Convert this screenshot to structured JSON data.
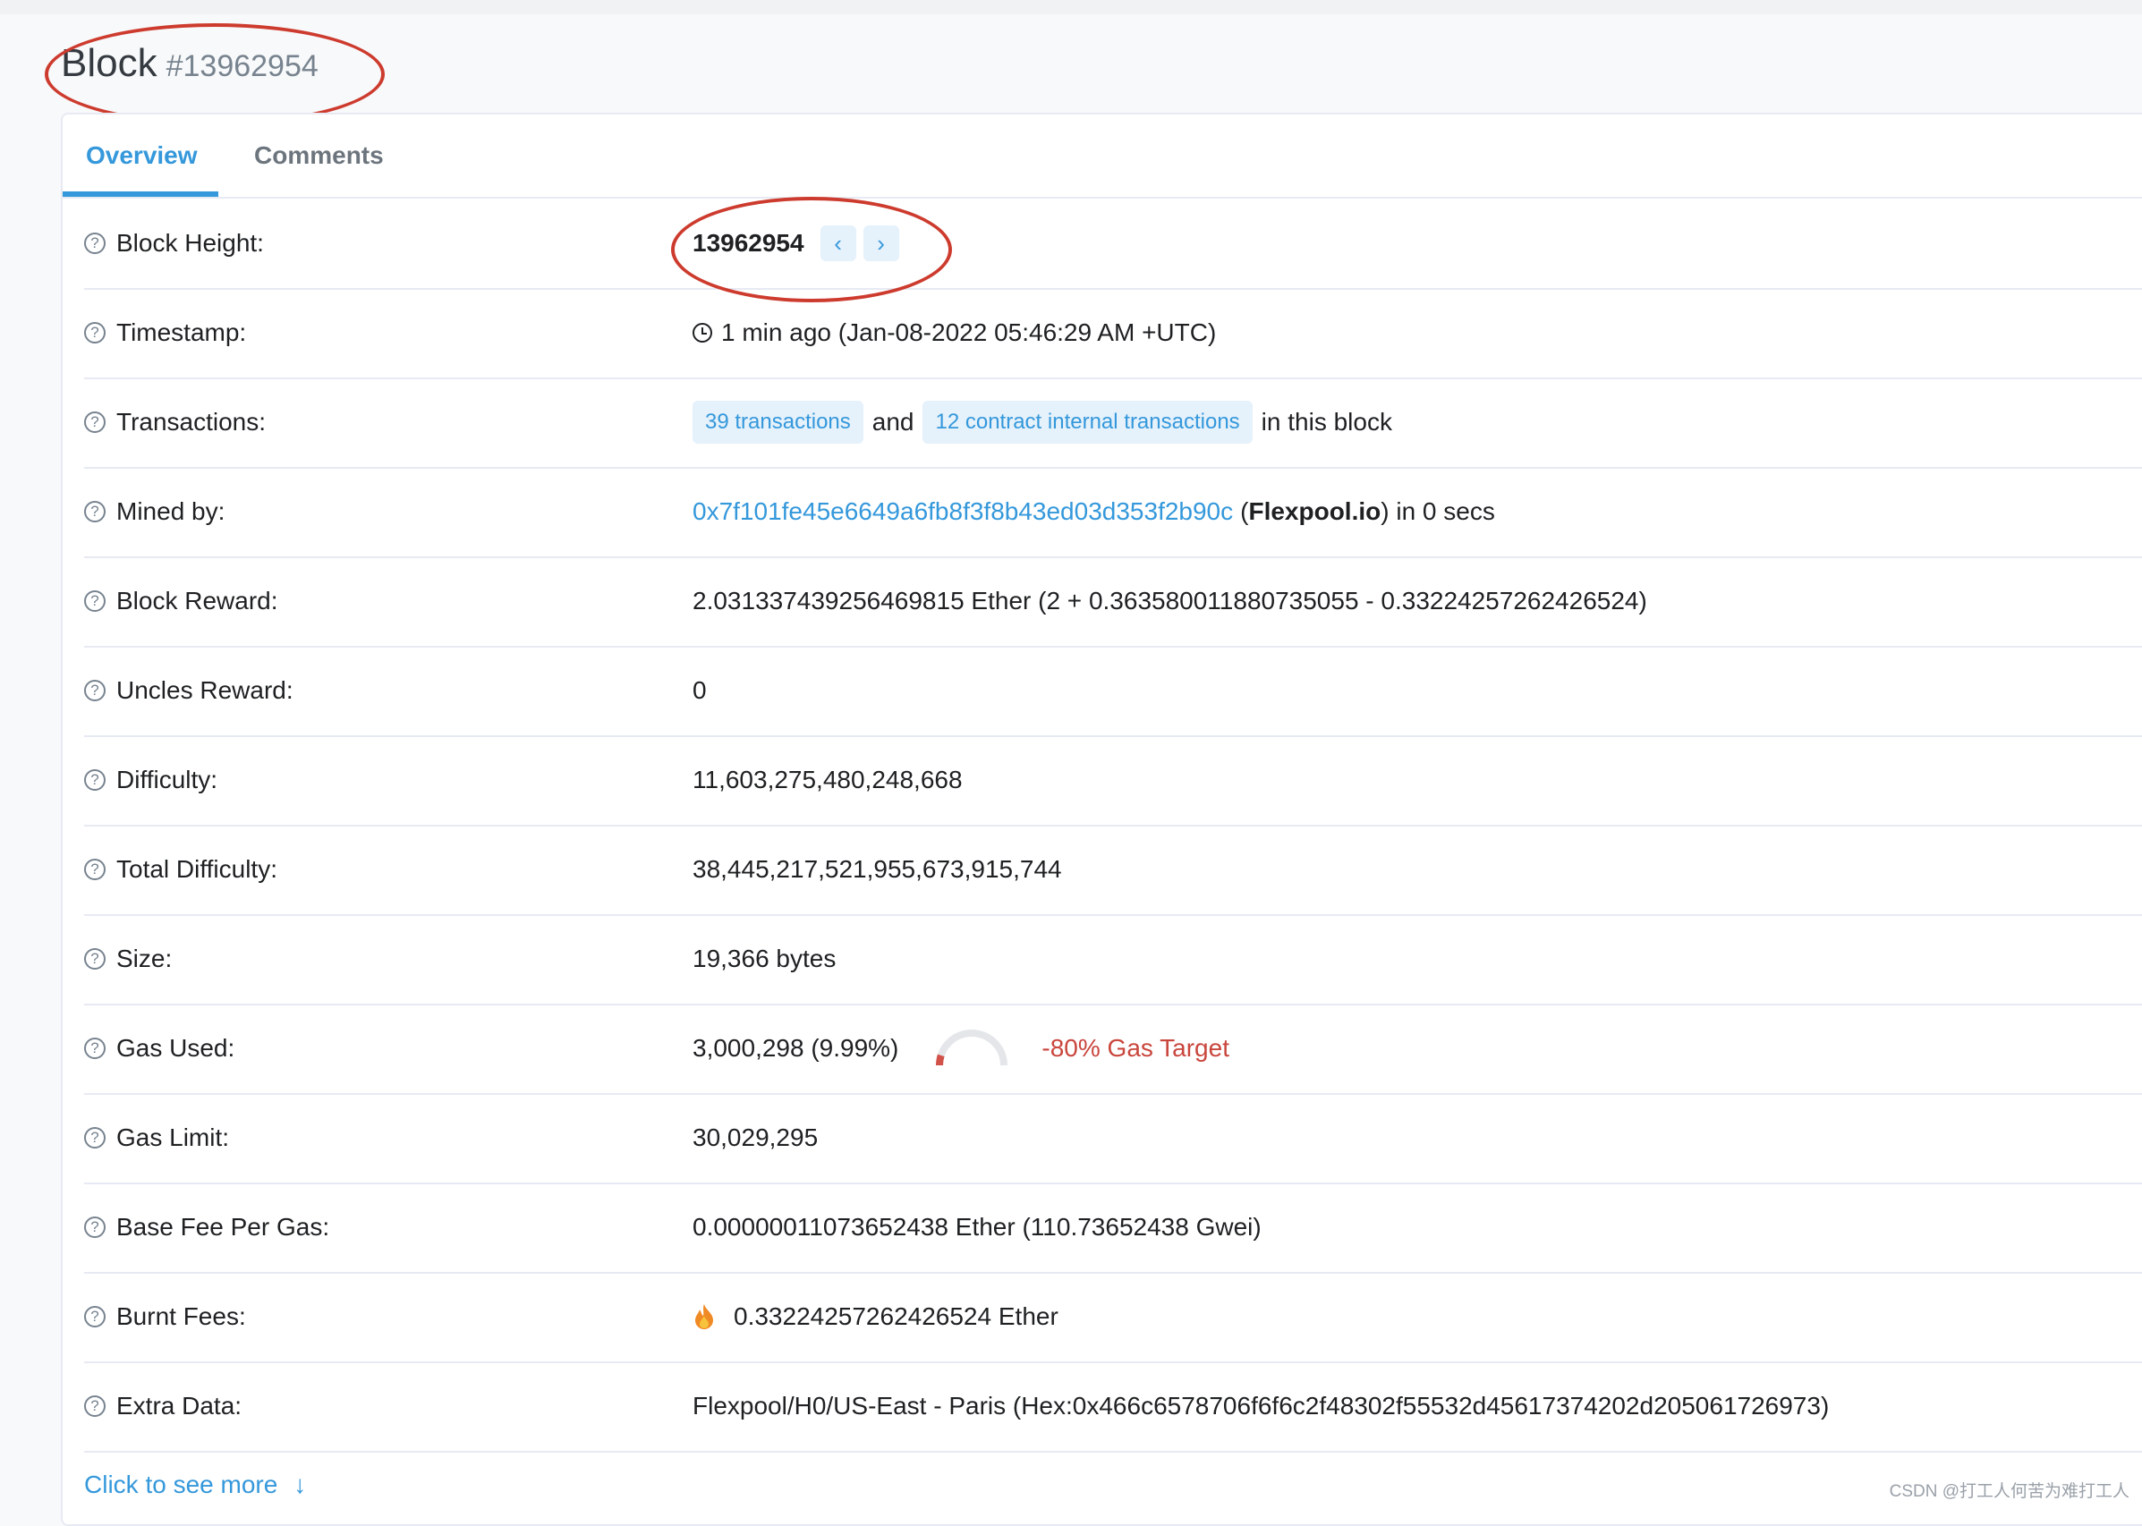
{
  "header": {
    "title": "Block",
    "number": "#13962954"
  },
  "tabs": [
    {
      "label": "Overview"
    },
    {
      "label": "Comments"
    }
  ],
  "rows": {
    "block_height": {
      "label": "Block Height:",
      "value": "13962954",
      "prev_glyph": "‹",
      "next_glyph": "›"
    },
    "timestamp": {
      "label": "Timestamp:",
      "value": "1 min ago (Jan-08-2022 05:46:29 AM +UTC)",
      "icon": "clock-icon"
    },
    "transactions": {
      "label": "Transactions:",
      "tx_link": "39 transactions",
      "and": "and",
      "internal_link": "12 contract internal transactions",
      "suffix": "in this block"
    },
    "mined_by": {
      "label": "Mined by:",
      "address": "0x7f101fe45e6649a6fb8f3f8b43ed03d353f2b90c",
      "open": "(",
      "pool": "Flexpool.io",
      "suffix": ") in 0 secs"
    },
    "block_reward": {
      "label": "Block Reward:",
      "value": "2.031337439256469815 Ether (2 + 0.363580011880735055 - 0.33224257262426524)"
    },
    "uncles_reward": {
      "label": "Uncles Reward:",
      "value": "0"
    },
    "difficulty": {
      "label": "Difficulty:",
      "value": "11,603,275,480,248,668"
    },
    "total_difficulty": {
      "label": "Total Difficulty:",
      "value": "38,445,217,521,955,673,915,744"
    },
    "size": {
      "label": "Size:",
      "value": "19,366 bytes"
    },
    "gas_used": {
      "label": "Gas Used:",
      "value": "3,000,298 (9.99%)",
      "gauge_fraction": 0.0999,
      "target": "-80% Gas Target"
    },
    "gas_limit": {
      "label": "Gas Limit:",
      "value": "30,029,295"
    },
    "base_fee": {
      "label": "Base Fee Per Gas:",
      "value": "0.00000011073652438 Ether (110.73652438 Gwei)"
    },
    "burnt_fees": {
      "label": "Burnt Fees:",
      "icon": "fire-icon",
      "value": "0.33224257262426524 Ether"
    },
    "extra_data": {
      "label": "Extra Data:",
      "value": "Flexpool/H0/US-East - Paris (Hex:0x466c6578706f6f6c2f48302f55532d45617374202d205061726973)"
    }
  },
  "more": {
    "label": "Click to see more",
    "arrow": "↓"
  },
  "help_glyph": "?",
  "colors": {
    "accent": "#3498db",
    "danger": "#c9463d",
    "annotation": "#cd3b2e"
  },
  "watermark": "CSDN @打工人何苦为难打工人"
}
